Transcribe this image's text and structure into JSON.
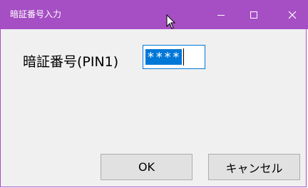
{
  "window": {
    "title": "暗証番号入力",
    "accent_color": "#a64ec4",
    "controls": {
      "minimize_icon": "minimize-icon",
      "maximize_icon": "maximize-icon",
      "close_icon": "close-icon"
    }
  },
  "form": {
    "label": "暗証番号(PIN1)",
    "pin_value": "****"
  },
  "buttons": {
    "ok_label": "OK",
    "cancel_label": "キャンセル"
  }
}
